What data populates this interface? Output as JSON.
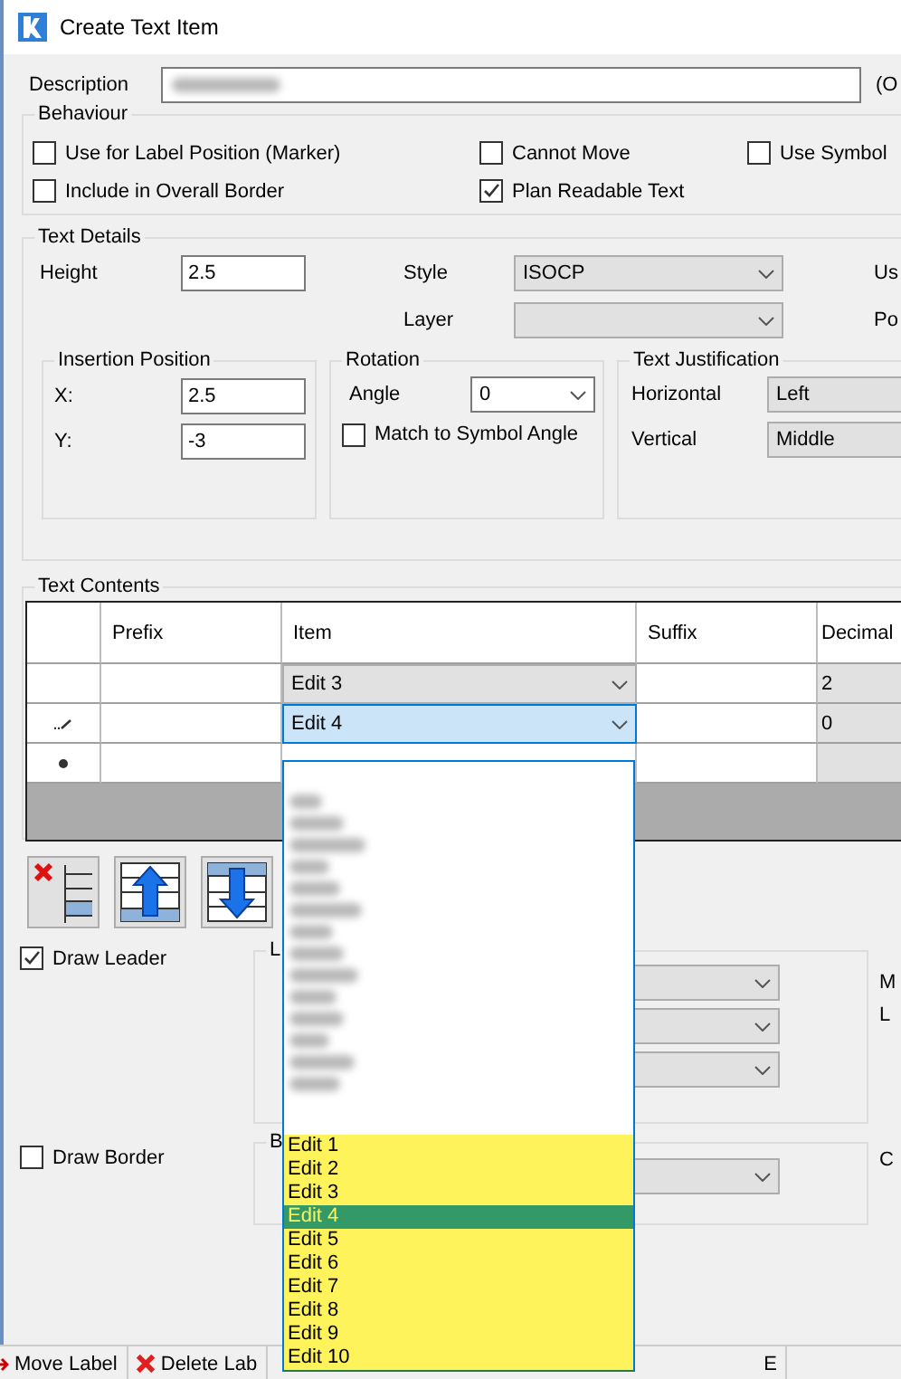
{
  "window": {
    "title": "Create Text Item"
  },
  "description": {
    "label": "Description",
    "note": "(O"
  },
  "behaviour": {
    "title": "Behaviour",
    "options": [
      {
        "label": "Use for Label Position (Marker)",
        "checked": false
      },
      {
        "label": "Cannot Move",
        "checked": false
      },
      {
        "label": "Use Symbol",
        "checked": false
      },
      {
        "label": "Include in Overall Border",
        "checked": false
      },
      {
        "label": "Plan Readable Text",
        "checked": true
      }
    ]
  },
  "text_details": {
    "title": "Text Details",
    "height": {
      "label": "Height",
      "value": "2.5"
    },
    "style": {
      "label": "Style",
      "value": "ISOCP"
    },
    "layer": {
      "label": "Layer"
    },
    "right_labels": [
      "Us",
      "Po"
    ],
    "insertion": {
      "title": "Insertion Position",
      "x": {
        "label": "X:",
        "value": "2.5"
      },
      "y": {
        "label": "Y:",
        "value": "-3"
      }
    },
    "rotation": {
      "title": "Rotation",
      "angle_label": "Angle",
      "angle": "0",
      "match": {
        "label": "Match to Symbol Angle",
        "checked": false
      }
    },
    "justification": {
      "title": "Text Justification",
      "horizontal": {
        "label": "Horizontal",
        "value": "Left"
      },
      "vertical": {
        "label": "Vertical",
        "value": "Middle"
      }
    }
  },
  "text_contents": {
    "title": "Text Contents",
    "columns": [
      "Prefix",
      "Item",
      "Suffix",
      "Decimal"
    ],
    "rows": [
      {
        "kind": "plain",
        "item": "Edit 3",
        "decimals": "2",
        "selected": false
      },
      {
        "kind": "editing",
        "item": "Edit 4",
        "decimals": "0",
        "selected": true
      },
      {
        "kind": "new"
      }
    ]
  },
  "draw_leader": {
    "label": "Draw Leader",
    "checked": true
  },
  "leader_group": {
    "title": "L",
    "right_labels": [
      "M",
      "L"
    ]
  },
  "draw_border": {
    "label": "Draw Border",
    "checked": false
  },
  "border_group": {
    "title": "B",
    "right_label": "C"
  },
  "dropdown": {
    "items": [
      {
        "label": "Edit 1",
        "selected": false
      },
      {
        "label": "Edit 2",
        "selected": false
      },
      {
        "label": "Edit 3",
        "selected": false
      },
      {
        "label": "Edit 4",
        "selected": true
      },
      {
        "label": "Edit 5",
        "selected": false
      },
      {
        "label": "Edit 6",
        "selected": false
      },
      {
        "label": "Edit 7",
        "selected": false
      },
      {
        "label": "Edit 8",
        "selected": false
      },
      {
        "label": "Edit 9",
        "selected": false
      },
      {
        "label": "Edit 10",
        "selected": false
      }
    ]
  },
  "taskbar": [
    {
      "kind": "move",
      "label": "Move Label"
    },
    {
      "kind": "delete",
      "label": "Delete Lab"
    },
    {
      "kind": "text",
      "label": "E"
    }
  ]
}
